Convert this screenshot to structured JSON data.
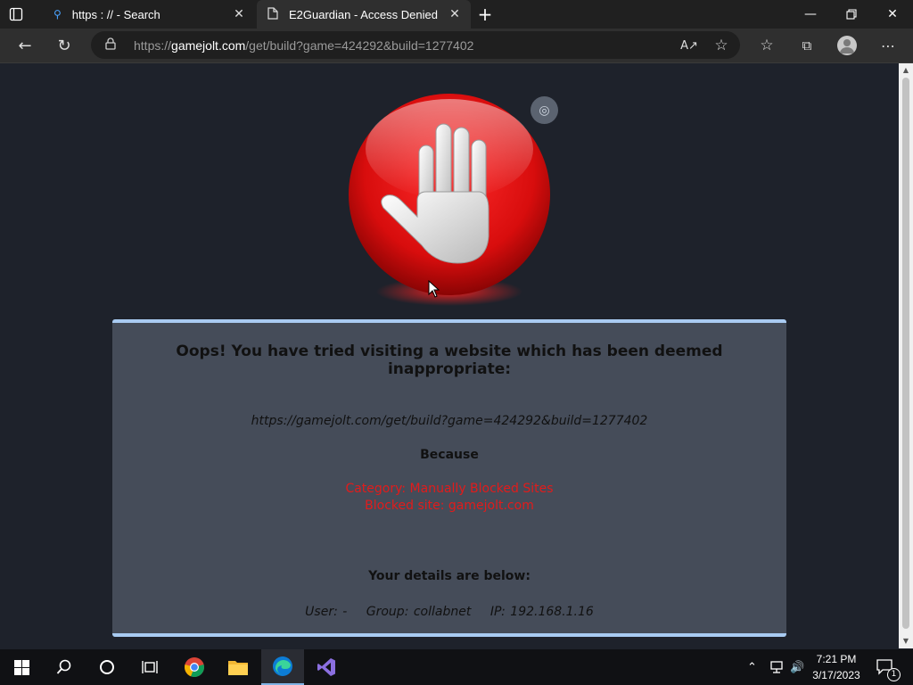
{
  "browser": {
    "tabs": [
      {
        "title": "https : // - Search",
        "icon": "search-icon",
        "active": false
      },
      {
        "title": "E2Guardian - Access Denied",
        "icon": "document-icon",
        "active": true
      }
    ],
    "address": {
      "prefix": "https://",
      "host": "gamejolt.com",
      "path": "/get/build?game=424292&build=1277402"
    }
  },
  "page": {
    "heading": "Oops! You have tried visiting a website which has been deemed inappropriate:",
    "blocked_url": "https://gamejolt.com/get/build?game=424292&build=1277402",
    "because_label": "Because",
    "reason_category": "Category: Manually Blocked Sites",
    "reason_site": "Blocked site: gamejolt.com",
    "details_label": "Your details are below:",
    "user": "User: -",
    "group": "Group: collabnet",
    "ip": "IP: 192.168.1.16",
    "colors": {
      "panel_bg": "#454c59",
      "panel_border": "#a9cbf2",
      "reason_text": "#e21b1b",
      "page_bg": "#1e222b"
    }
  },
  "taskbar": {
    "time": "7:21 PM",
    "date": "3/17/2023",
    "notification_count": "1",
    "apps": [
      "windows-start-icon",
      "search-icon",
      "cortana-icon",
      "task-view-icon",
      "chrome-icon",
      "file-explorer-icon",
      "edge-icon",
      "visual-studio-icon"
    ]
  }
}
